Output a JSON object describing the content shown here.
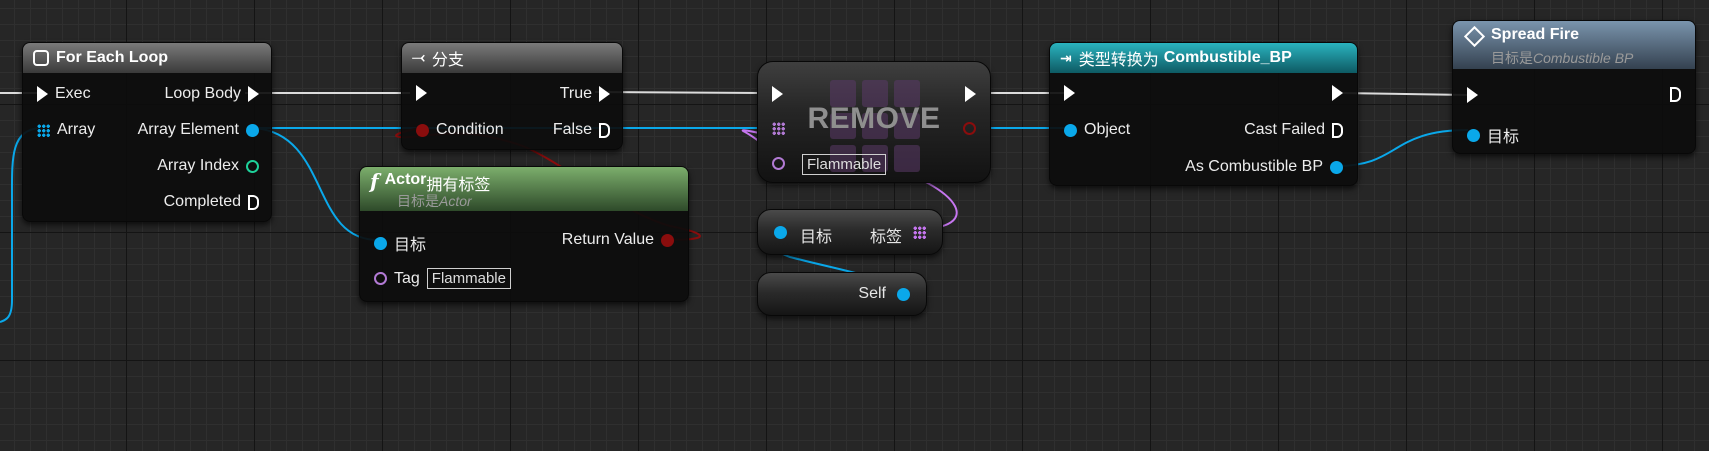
{
  "colors": {
    "exec": "#ffffff",
    "object_pin": "#0aa8ea",
    "bool_pin": "#8a0d0d",
    "int_pin": "#1ed19a",
    "name_pin": "#b27ad4",
    "tag_wire": "#c676f0",
    "foreach_header": "#6a6a6a",
    "branch_header": "#6a6a6a",
    "function_header": "#5a8a4e",
    "cast_header": "#1a8f9b",
    "event_header": "#4f6478"
  },
  "foreach": {
    "title": "For Each Loop",
    "icon": "loop-icon",
    "exec": "Exec",
    "loop_body": "Loop Body",
    "array": "Array",
    "array_element": "Array Element",
    "array_index": "Array Index",
    "completed": "Completed"
  },
  "branch": {
    "title": "分支",
    "icon": "branch-icon",
    "true_label": "True",
    "condition": "Condition",
    "false_label": "False"
  },
  "remove": {
    "title": "REMOVE",
    "value": "Flammable"
  },
  "has_tag": {
    "title_prefix": "Actor",
    "title_suffix": "拥有标签",
    "subtitle_prefix": "目标是",
    "subtitle_target": "Actor",
    "target": "目标",
    "return_value": "Return Value",
    "tag": "Tag",
    "tag_value": "Flammable"
  },
  "tags_getter": {
    "target": "目标",
    "tags": "标签"
  },
  "self_node": {
    "label": "Self"
  },
  "cast": {
    "title_prefix": "类型转换为",
    "title_class": "Combustible_BP",
    "object": "Object",
    "cast_failed": "Cast Failed",
    "as_output": "As Combustible BP"
  },
  "spread_fire": {
    "title": "Spread Fire",
    "subtitle_prefix": "目标是",
    "subtitle_target": "Combustible BP",
    "target": "目标"
  }
}
